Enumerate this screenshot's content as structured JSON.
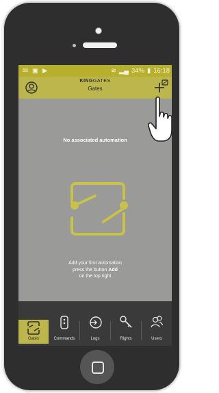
{
  "status_bar": {
    "signal": "34%",
    "time": "16:18"
  },
  "header": {
    "brand": "KING",
    "brand_suffix": "GATES",
    "title": "Gates"
  },
  "empty_state": {
    "title": "No associated automation",
    "line1": "Add your first automation",
    "line2_prefix": "press the button",
    "line2_bold": "Add",
    "line3": "on the top right"
  },
  "tabs": [
    {
      "label": "Gates",
      "icon": "gate-icon",
      "active": true
    },
    {
      "label": "Commands",
      "icon": "remote-icon",
      "active": false
    },
    {
      "label": "Logs",
      "icon": "logs-icon",
      "active": false
    },
    {
      "label": "Rights",
      "icon": "key-icon",
      "active": false
    },
    {
      "label": "Users",
      "icon": "users-icon",
      "active": false
    }
  ],
  "colors": {
    "accent": "#bdb64d",
    "status_bar": "#b8b02c",
    "screen_bg": "#9a9a98",
    "tab_bar": "#3a3a3a",
    "illustration": "#c8c14a"
  }
}
